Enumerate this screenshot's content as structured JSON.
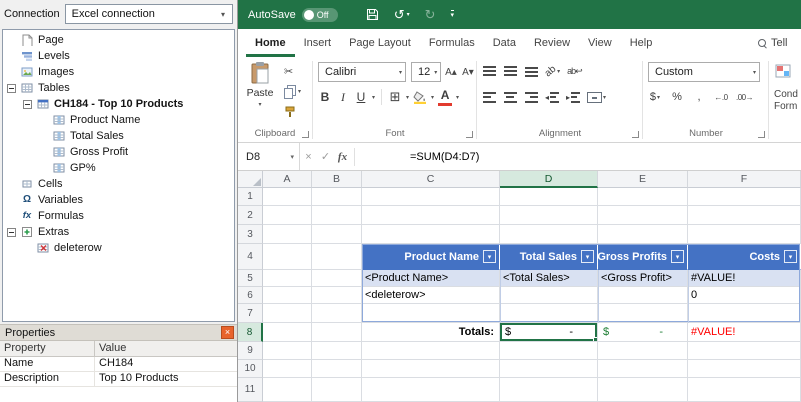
{
  "colors": {
    "excel_green": "#217346",
    "table_header_blue": "#4472C4",
    "banded_row_blue": "#D9E1F2",
    "selection_green": "#217346",
    "error_red": "#FF0000",
    "totals_green": "#1E7E34"
  },
  "icons": {
    "dropdown": "▾",
    "close": "×",
    "cancel": "×",
    "enter": "✓",
    "fx": "fx",
    "scissors": "✂",
    "bold": "B",
    "italic": "I",
    "underline": "U",
    "borders": "⊞",
    "font_color": "A",
    "grow_font": "A▴",
    "shrink_font": "A▾",
    "dollar": "$",
    "percent": "%",
    "comma": ",",
    "increase_decimal": "←.0",
    "decrease_decimal": ".00→",
    "undo": "↺",
    "redo": "↻",
    "orientation": "ab",
    "wrap_text": "ab↩",
    "indent_left": "◂",
    "indent_right": "▸"
  },
  "left_panel": {
    "connection_label": "Connection",
    "connection_value": "Excel connection",
    "tree": {
      "items": [
        {
          "label": "Page",
          "level": 1,
          "icon": "page-icon"
        },
        {
          "label": "Levels",
          "level": 1,
          "icon": "levels-icon"
        },
        {
          "label": "Images",
          "level": 1,
          "icon": "images-icon"
        },
        {
          "label": "Tables",
          "level": 1,
          "icon": "tables-icon",
          "expanded": true
        },
        {
          "label": "CH184 - Top 10 Products",
          "level": 2,
          "icon": "table-icon",
          "expanded": true,
          "bold": true
        },
        {
          "label": "Product Name",
          "level": 3,
          "icon": "column-icon"
        },
        {
          "label": "Total Sales",
          "level": 3,
          "icon": "column-icon"
        },
        {
          "label": "Gross Profit",
          "level": 3,
          "icon": "column-icon"
        },
        {
          "label": "GP%",
          "level": 3,
          "icon": "column-icon"
        },
        {
          "label": "Cells",
          "level": 1,
          "icon": "cells-icon"
        },
        {
          "label": "Variables",
          "level": 1,
          "icon": "omega-icon"
        },
        {
          "label": "Formulas",
          "level": 1,
          "icon": "fx-icon"
        },
        {
          "label": "Extras",
          "level": 1,
          "icon": "extras-icon",
          "expanded": true
        },
        {
          "label": "deleterow",
          "level": 2,
          "icon": "deleterow-icon"
        }
      ]
    },
    "properties": {
      "title": "Properties",
      "columns": [
        "Property",
        "Value"
      ],
      "rows": [
        [
          "Name",
          "CH184"
        ],
        [
          "Description",
          "Top 10 Products"
        ]
      ]
    }
  },
  "excel": {
    "titlebar": {
      "autosave_label": "AutoSave",
      "autosave_state": "Off"
    },
    "ribbon_tabs": [
      "Home",
      "Insert",
      "Page Layout",
      "Formulas",
      "Data",
      "Review",
      "View",
      "Help"
    ],
    "active_tab": "Home",
    "tell_me": "Tell",
    "groups": {
      "clipboard": {
        "label": "Clipboard",
        "paste": "Paste"
      },
      "font": {
        "label": "Font",
        "font_name": "Calibri",
        "font_size": "12"
      },
      "alignment": {
        "label": "Alignment"
      },
      "number": {
        "label": "Number",
        "format": "Custom"
      },
      "styles": {
        "line1": "Cond",
        "line2": "Form"
      }
    },
    "formula_bar": {
      "name_box": "D8",
      "formula": "=SUM(D4:D7)"
    },
    "grid": {
      "columns": [
        "A",
        "B",
        "C",
        "D",
        "E",
        "F"
      ],
      "rows": [
        "1",
        "2",
        "3",
        "4",
        "5",
        "6",
        "7",
        "8",
        "9",
        "10",
        "11"
      ],
      "selected_cell": "D8",
      "cells": {
        "C4": {
          "text": "Product Name",
          "cls": "th-blue",
          "filter": true
        },
        "D4": {
          "text": "Total Sales",
          "cls": "th-blue",
          "filter": true
        },
        "E4": {
          "text": "Gross Profits",
          "cls": "th-blue",
          "filter": true
        },
        "F4": {
          "text": "Costs",
          "cls": "th-blue",
          "filter": true
        },
        "C5": {
          "text": "<Product Name>",
          "cls": "band"
        },
        "D5": {
          "text": "<Total Sales>",
          "cls": "band"
        },
        "E5": {
          "text": "<Gross Profit>",
          "cls": "band"
        },
        "F5": {
          "text": "#VALUE!",
          "cls": "band"
        },
        "C6": {
          "text": "<deleterow>",
          "cls": ""
        },
        "F6": {
          "text": "0",
          "cls": ""
        },
        "C8": {
          "text": "Totals:",
          "cls": "totals"
        },
        "D8": {
          "cur": "$",
          "val": "-",
          "cls": "acct sel-cell"
        },
        "E8": {
          "cur": "$",
          "val": "-",
          "cls": "acct green-val"
        },
        "F8": {
          "text": "#VALUE!",
          "cls": "error"
        }
      }
    }
  }
}
